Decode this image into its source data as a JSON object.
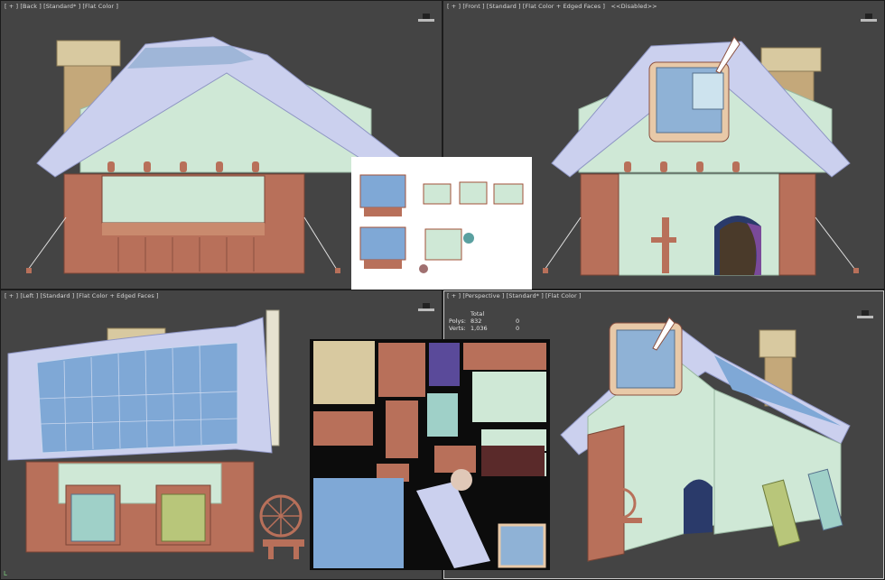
{
  "viewports": {
    "top_left": {
      "label": "[ + ] [Back ] [Standard* ] [Flat Color ]",
      "icon": "viewcube-hat-icon"
    },
    "top_right": {
      "label": "[ + ] [Front ] [Standard ] [Flat Color + Edged Faces ]   <<Disabled>>",
      "icon": "viewcube-hat-icon"
    },
    "bottom_left": {
      "label": "[ + ] [Left ] [Standard ] [Flat Color + Edged Faces ]",
      "icon": "viewcube-hat-icon"
    },
    "bottom_right": {
      "label": "[ + ] [Perspective ] [Standard* ] [Flat Color ]",
      "icon": "viewcube-hat-icon"
    }
  },
  "stats": {
    "title": "Total",
    "polys_label": "Polys:",
    "polys_value": "832",
    "polys_sel": "0",
    "verts_label": "Verts:",
    "verts_value": "1,036",
    "verts_sel": "0"
  },
  "overlays": {
    "concept_art": "concept-reference-sheet",
    "uv_texture": "uv-texture-atlas"
  },
  "colors": {
    "viewport_bg": "#444444",
    "roof": "#cbd0ee",
    "wall": "#cfe8d6",
    "wood": "#b8705a",
    "stone": "#c9b48f",
    "window_blue": "#8fb2d6"
  },
  "axis_gizmo": "L"
}
